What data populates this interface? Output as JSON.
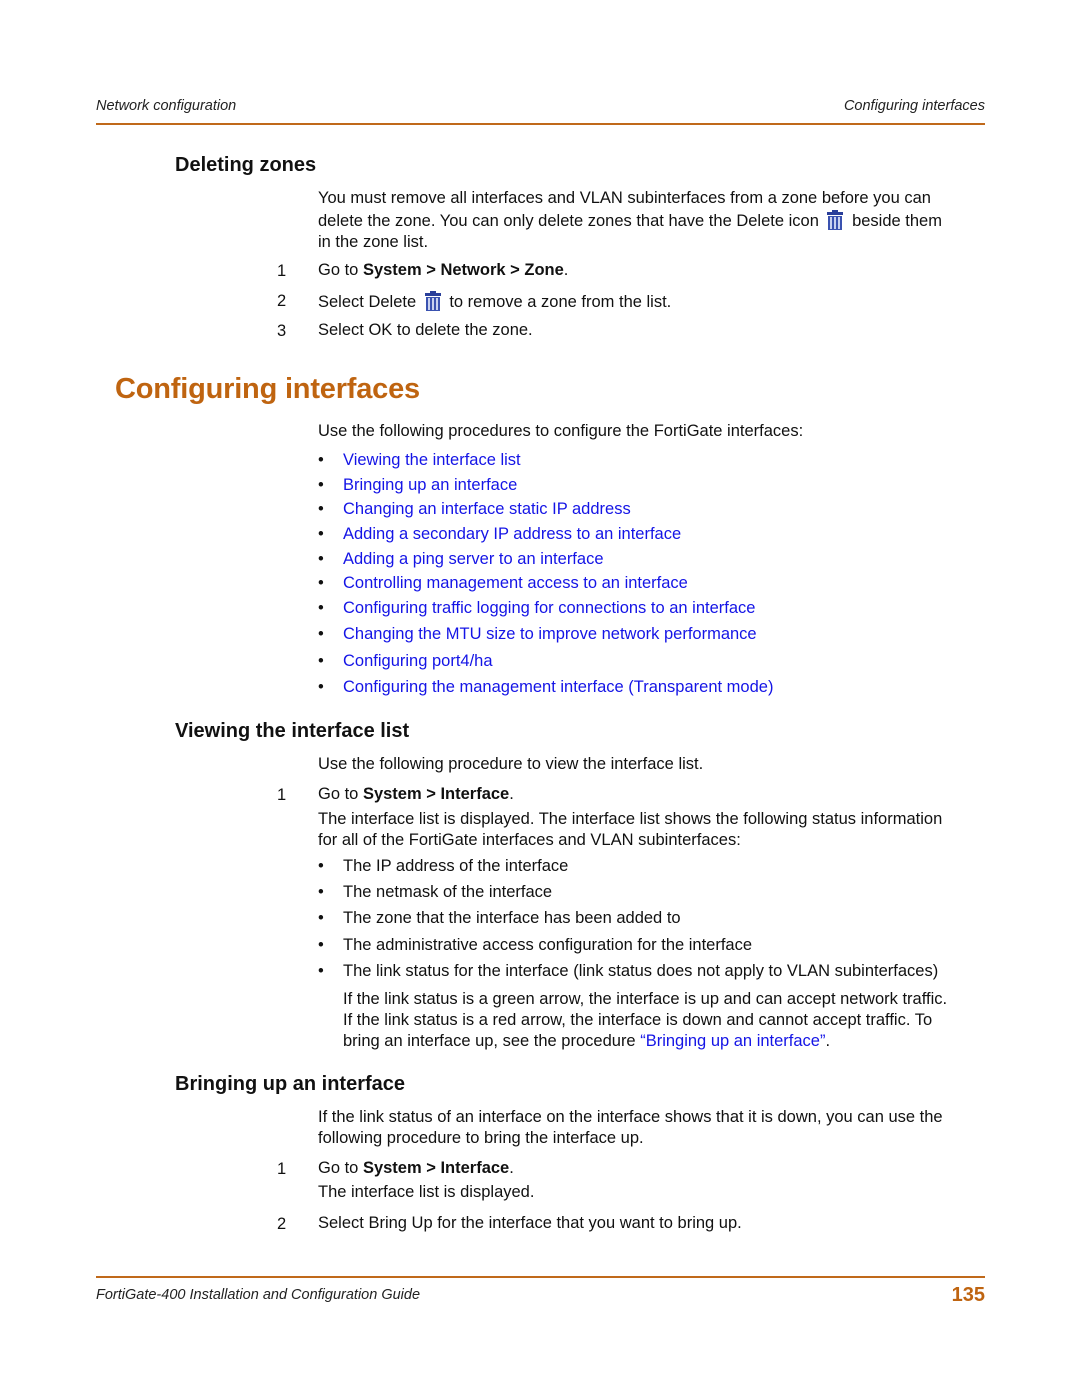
{
  "header": {
    "left": "Network configuration",
    "right": "Configuring interfaces"
  },
  "deleting_zones": {
    "title": "Deleting zones",
    "intro_line1": "You must remove all interfaces and VLAN subinterfaces from a zone before you can",
    "intro_line2_a": "delete the zone. You can only delete zones that have the Delete icon",
    "intro_line2_b": "beside them",
    "intro_line3": "in the zone list.",
    "steps": [
      {
        "num": "1",
        "pre": "Go to ",
        "bold": "System > Network > Zone",
        "post": "."
      },
      {
        "num": "2",
        "pre": "Select Delete",
        "post": "to remove a zone from the list."
      },
      {
        "num": "3",
        "text": "Select OK to delete the zone."
      }
    ],
    "icon": "trash-icon"
  },
  "configuring_interfaces": {
    "title": "Configuring interfaces",
    "intro": "Use the following procedures to configure the FortiGate interfaces:",
    "links": [
      "Viewing the interface list",
      "Bringing up an interface",
      "Changing an interface static IP address",
      "Adding a secondary IP address to an interface",
      "Adding a ping server to an interface",
      "Controlling management access to an interface",
      "Configuring traffic logging for connections to an interface",
      "Changing the MTU size to improve network performance",
      "Configuring port4/ha",
      "Configuring the management interface (Transparent mode)"
    ]
  },
  "viewing_list": {
    "title": "Viewing the interface list",
    "intro": "Use the following procedure to view the interface list.",
    "step1": {
      "num": "1",
      "pre": "Go to ",
      "bold": "System > Interface",
      "post": "."
    },
    "desc_line1": "The interface list is displayed. The interface list shows the following status information",
    "desc_line2": "for all of the FortiGate interfaces and VLAN subinterfaces:",
    "bullets": [
      "The IP address of the interface",
      "The netmask of the interface",
      "The zone that the interface has been added to",
      "The administrative access configuration for the interface",
      "The link status for the interface (link status does not apply to VLAN subinterfaces)"
    ],
    "note_line1": "If the link status is a green arrow, the interface is up and can accept network traffic.",
    "note_line2": "If the link status is a red arrow, the interface is down and cannot accept traffic. To",
    "note_line3_pre": "bring an interface up, see the procedure ",
    "note_line3_link": "“Bringing up an interface”",
    "note_line3_post": "."
  },
  "bringing_up": {
    "title": "Bringing up an interface",
    "intro_line1": "If the link status of an interface on the interface shows that it is down, you can use the",
    "intro_line2": "following procedure to bring the interface up.",
    "step1": {
      "num": "1",
      "pre": "Go to ",
      "bold": "System > Interface",
      "post": "."
    },
    "step1_result": "The interface list is displayed.",
    "step2": {
      "num": "2",
      "text": "Select Bring Up for the interface that you want to bring up."
    }
  },
  "footer": {
    "title": "FortiGate-400 Installation and Configuration Guide",
    "page_number": "135"
  },
  "colors": {
    "accent": "#bf6410",
    "link": "#1414e6",
    "icon": "#2a3f9a"
  }
}
